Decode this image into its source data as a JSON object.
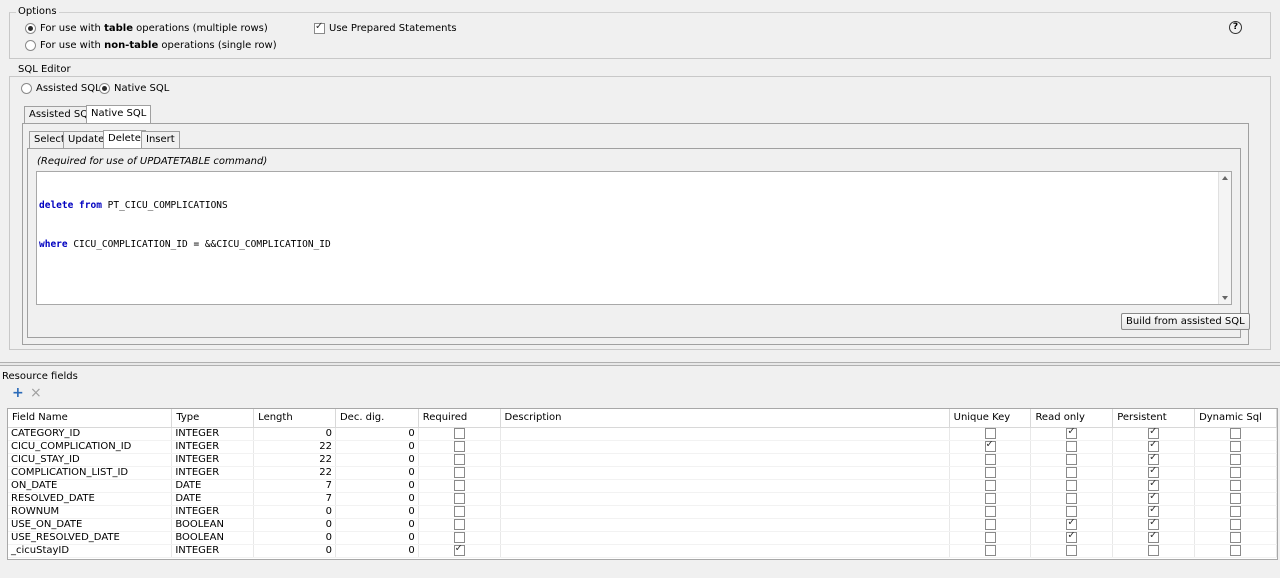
{
  "options": {
    "label": "Options",
    "radio_table": {
      "pre": "For use with ",
      "bold": "table",
      "post": " operations (multiple rows)",
      "checked": true
    },
    "radio_nontable": {
      "pre": "For use with ",
      "bold": "non-table",
      "post": " operations (single row)",
      "checked": false
    },
    "prepared_label": "Use Prepared Statements",
    "prepared_checked": true,
    "help": "?"
  },
  "sql_editor": {
    "label": "SQL Editor",
    "mode_assisted": "Assisted SQL",
    "mode_native": "Native SQL",
    "selected_mode": "Native SQL",
    "outer_tabs": [
      "Assisted SQL",
      "Native SQL"
    ],
    "inner_tabs": [
      "Select",
      "Update",
      "Delete",
      "Insert"
    ],
    "active_inner_tab": "Delete",
    "note": "(Required for use of UPDATETABLE command)",
    "sql_line1_kw": "delete from",
    "sql_line1_rest": " PT_CICU_COMPLICATIONS",
    "sql_line2_kw": "where",
    "sql_line2_rest": " CICU_COMPLICATION_ID = &&CICU_COMPLICATION_ID",
    "build_button": "Build from assisted SQL"
  },
  "resource_fields": {
    "label": "Resource fields",
    "add_icon": "+",
    "remove_icon": "×",
    "columns": [
      "Field Name",
      "Type",
      "Length",
      "Dec. dig.",
      "Required",
      "Description",
      "Unique Key",
      "Read only",
      "Persistent",
      "Dynamic Sql"
    ],
    "rows": [
      {
        "name": "CATEGORY_ID",
        "type": "INTEGER",
        "length": "0",
        "dec": "0",
        "required": false,
        "description": "",
        "unique": false,
        "readonly": true,
        "persistent": true,
        "dynamic": false
      },
      {
        "name": "CICU_COMPLICATION_ID",
        "type": "INTEGER",
        "length": "22",
        "dec": "0",
        "required": false,
        "description": "",
        "unique": true,
        "readonly": false,
        "persistent": true,
        "dynamic": false
      },
      {
        "name": "CICU_STAY_ID",
        "type": "INTEGER",
        "length": "22",
        "dec": "0",
        "required": false,
        "description": "",
        "unique": false,
        "readonly": false,
        "persistent": true,
        "dynamic": false
      },
      {
        "name": "COMPLICATION_LIST_ID",
        "type": "INTEGER",
        "length": "22",
        "dec": "0",
        "required": false,
        "description": "",
        "unique": false,
        "readonly": false,
        "persistent": true,
        "dynamic": false
      },
      {
        "name": "ON_DATE",
        "type": "DATE",
        "length": "7",
        "dec": "0",
        "required": false,
        "description": "",
        "unique": false,
        "readonly": false,
        "persistent": true,
        "dynamic": false
      },
      {
        "name": "RESOLVED_DATE",
        "type": "DATE",
        "length": "7",
        "dec": "0",
        "required": false,
        "description": "",
        "unique": false,
        "readonly": false,
        "persistent": true,
        "dynamic": false
      },
      {
        "name": "ROWNUM",
        "type": "INTEGER",
        "length": "0",
        "dec": "0",
        "required": false,
        "description": "",
        "unique": false,
        "readonly": false,
        "persistent": true,
        "dynamic": false
      },
      {
        "name": "USE_ON_DATE",
        "type": "BOOLEAN",
        "length": "0",
        "dec": "0",
        "required": false,
        "description": "",
        "unique": false,
        "readonly": true,
        "persistent": true,
        "dynamic": false
      },
      {
        "name": "USE_RESOLVED_DATE",
        "type": "BOOLEAN",
        "length": "0",
        "dec": "0",
        "required": false,
        "description": "",
        "unique": false,
        "readonly": true,
        "persistent": true,
        "dynamic": false
      },
      {
        "name": "_cicuStayID",
        "type": "INTEGER",
        "length": "0",
        "dec": "0",
        "required": true,
        "description": "",
        "unique": false,
        "readonly": false,
        "persistent": false,
        "dynamic": false
      }
    ]
  }
}
